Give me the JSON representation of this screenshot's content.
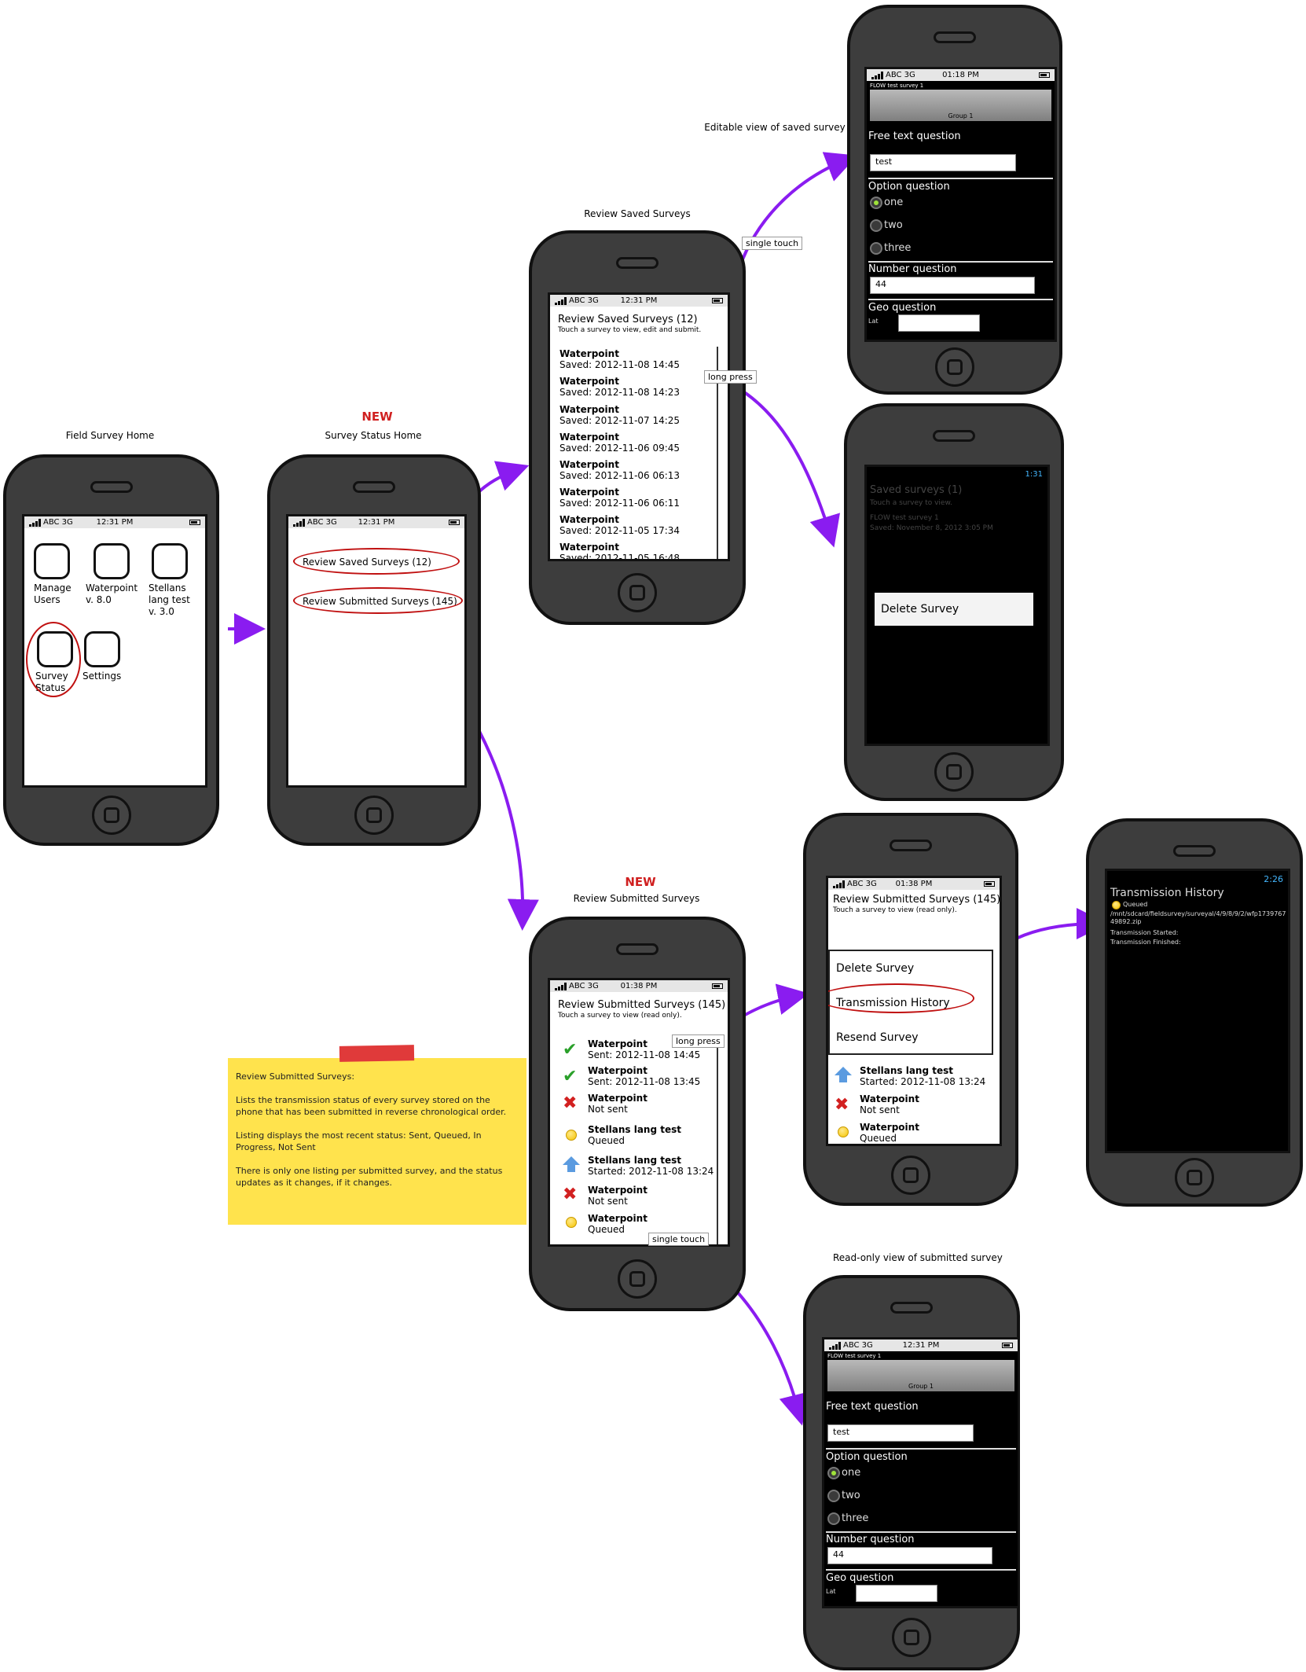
{
  "phones": {
    "home": {
      "caption": "Field Survey Home",
      "status": {
        "carrier": "ABC 3G",
        "time": "12:31 PM"
      },
      "apps": [
        {
          "label": "Manage Users"
        },
        {
          "label": "Waterpoint v. 8.0"
        },
        {
          "label": "Stellans lang test v. 3.0"
        },
        {
          "label": "Survey Status"
        },
        {
          "label": "Settings"
        }
      ]
    },
    "status_home": {
      "new_tag": "NEW",
      "caption": "Survey Status Home",
      "status": {
        "carrier": "ABC 3G",
        "time": "12:31 PM"
      },
      "links": [
        "Review Saved Surveys (12)",
        "Review Submitted Surveys (145)"
      ]
    },
    "saved": {
      "caption": "Review Saved Surveys",
      "status": {
        "carrier": "ABC 3G",
        "time": "12:31 PM"
      },
      "title": "Review Saved Surveys (12)",
      "subtitle": "Touch a survey to view, edit and submit.",
      "items": [
        {
          "name": "Waterpoint",
          "detail": "Saved: 2012-11-08 14:45"
        },
        {
          "name": "Waterpoint",
          "detail": "Saved: 2012-11-08 14:23"
        },
        {
          "name": "Waterpoint",
          "detail": "Saved: 2012-11-07 14:25"
        },
        {
          "name": "Waterpoint",
          "detail": "Saved: 2012-11-06 09:45"
        },
        {
          "name": "Waterpoint",
          "detail": "Saved: 2012-11-06 06:13"
        },
        {
          "name": "Waterpoint",
          "detail": "Saved: 2012-11-06 06:11"
        },
        {
          "name": "Waterpoint",
          "detail": "Saved: 2012-11-05 17:34"
        },
        {
          "name": "Waterpoint",
          "detail": "Saved: 2012-11-05 16:48"
        }
      ]
    },
    "editable": {
      "caption": "Editable view of saved survey",
      "status": {
        "carrier": "ABC 3G",
        "time": "01:18 PM"
      },
      "survey_title": "FLOW test survey 1",
      "group": "Group 1",
      "free_text_label": "Free text question",
      "free_text_value": "test",
      "option_label": "Option question",
      "options": [
        "one",
        "two",
        "three"
      ],
      "number_label": "Number question",
      "number_value": "44",
      "geo_label": "Geo question",
      "lat_label": "Lat"
    },
    "delete_saved": {
      "status_time": "1:31",
      "title": "Saved surveys (1)",
      "subtitle": "Touch a survey to view.",
      "survey": "FLOW test survey 1",
      "saved": "Saved: November 8, 2012 3:05 PM",
      "menu_item": "Delete Survey"
    },
    "submitted": {
      "new_tag": "NEW",
      "caption": "Review Submitted Surveys",
      "status": {
        "carrier": "ABC 3G",
        "time": "01:38 PM"
      },
      "title": "Review Submitted Surveys (145)",
      "subtitle": "Touch a survey to view (read only).",
      "items": [
        {
          "name": "Waterpoint",
          "detail": "Sent: 2012-11-08 14:45",
          "icon": "check"
        },
        {
          "name": "Waterpoint",
          "detail": "Sent: 2012-11-08 13:45",
          "icon": "check"
        },
        {
          "name": "Waterpoint",
          "detail": "Not sent",
          "icon": "x"
        },
        {
          "name": "Stellans lang test",
          "detail": "Queued",
          "icon": "queued"
        },
        {
          "name": "Stellans lang test",
          "detail": "Started: 2012-11-08 13:24",
          "icon": "arrow"
        },
        {
          "name": "Waterpoint",
          "detail": "Not sent",
          "icon": "x"
        },
        {
          "name": "Waterpoint",
          "detail": "Queued",
          "icon": "queued"
        }
      ]
    },
    "submitted_menu": {
      "status": {
        "carrier": "ABC 3G",
        "time": "01:38 PM"
      },
      "title": "Review Submitted Surveys (145)",
      "subtitle": "Touch a survey to view (read only).",
      "menu": [
        "Delete Survey",
        "Transmission History",
        "Resend Survey"
      ],
      "items": [
        {
          "name": "Stellans lang test",
          "detail": "Started: 2012-11-08 13:24",
          "icon": "arrow"
        },
        {
          "name": "Waterpoint",
          "detail": "Not sent",
          "icon": "x"
        },
        {
          "name": "Waterpoint",
          "detail": "Queued",
          "icon": "queued"
        }
      ]
    },
    "history": {
      "status_time": "2:26",
      "title": "Transmission History",
      "queued": "Queued",
      "path": "/mnt/sdcard/fieldsurvey/surveyal/4/9/8/9/2/wfp173976749892.zip",
      "started": "Transmission Started:",
      "finished": "Transmission Finished:"
    },
    "readonly": {
      "caption": "Read-only view of submitted survey",
      "status": {
        "carrier": "ABC 3G",
        "time": "12:31 PM"
      },
      "survey_title": "FLOW test survey 1",
      "group": "Group 1",
      "free_text_label": "Free text question",
      "free_text_value": "test",
      "option_label": "Option question",
      "options": [
        "one",
        "two",
        "three"
      ],
      "number_label": "Number question",
      "number_value": "44",
      "geo_label": "Geo question",
      "lat_label": "Lat"
    }
  },
  "connectors": {
    "single_touch_1": "single touch",
    "long_press_1": "long press",
    "long_press_2": "long press",
    "single_touch_2": "single touch"
  },
  "note": {
    "title": "Review Submitted Surveys:",
    "p1": "Lists the transmission status of every survey stored on the phone that has been submitted in reverse chronological order.",
    "p2": "Listing displays the most recent status: Sent, Queued, In Progress, Not Sent",
    "p3": "There is only one listing per submitted survey, and the status updates as it changes, if it changes."
  },
  "colors": {
    "arrow": "#8a1cf0",
    "highlight": "#c01010",
    "new": "#d02020",
    "note": "#ffe34d"
  }
}
